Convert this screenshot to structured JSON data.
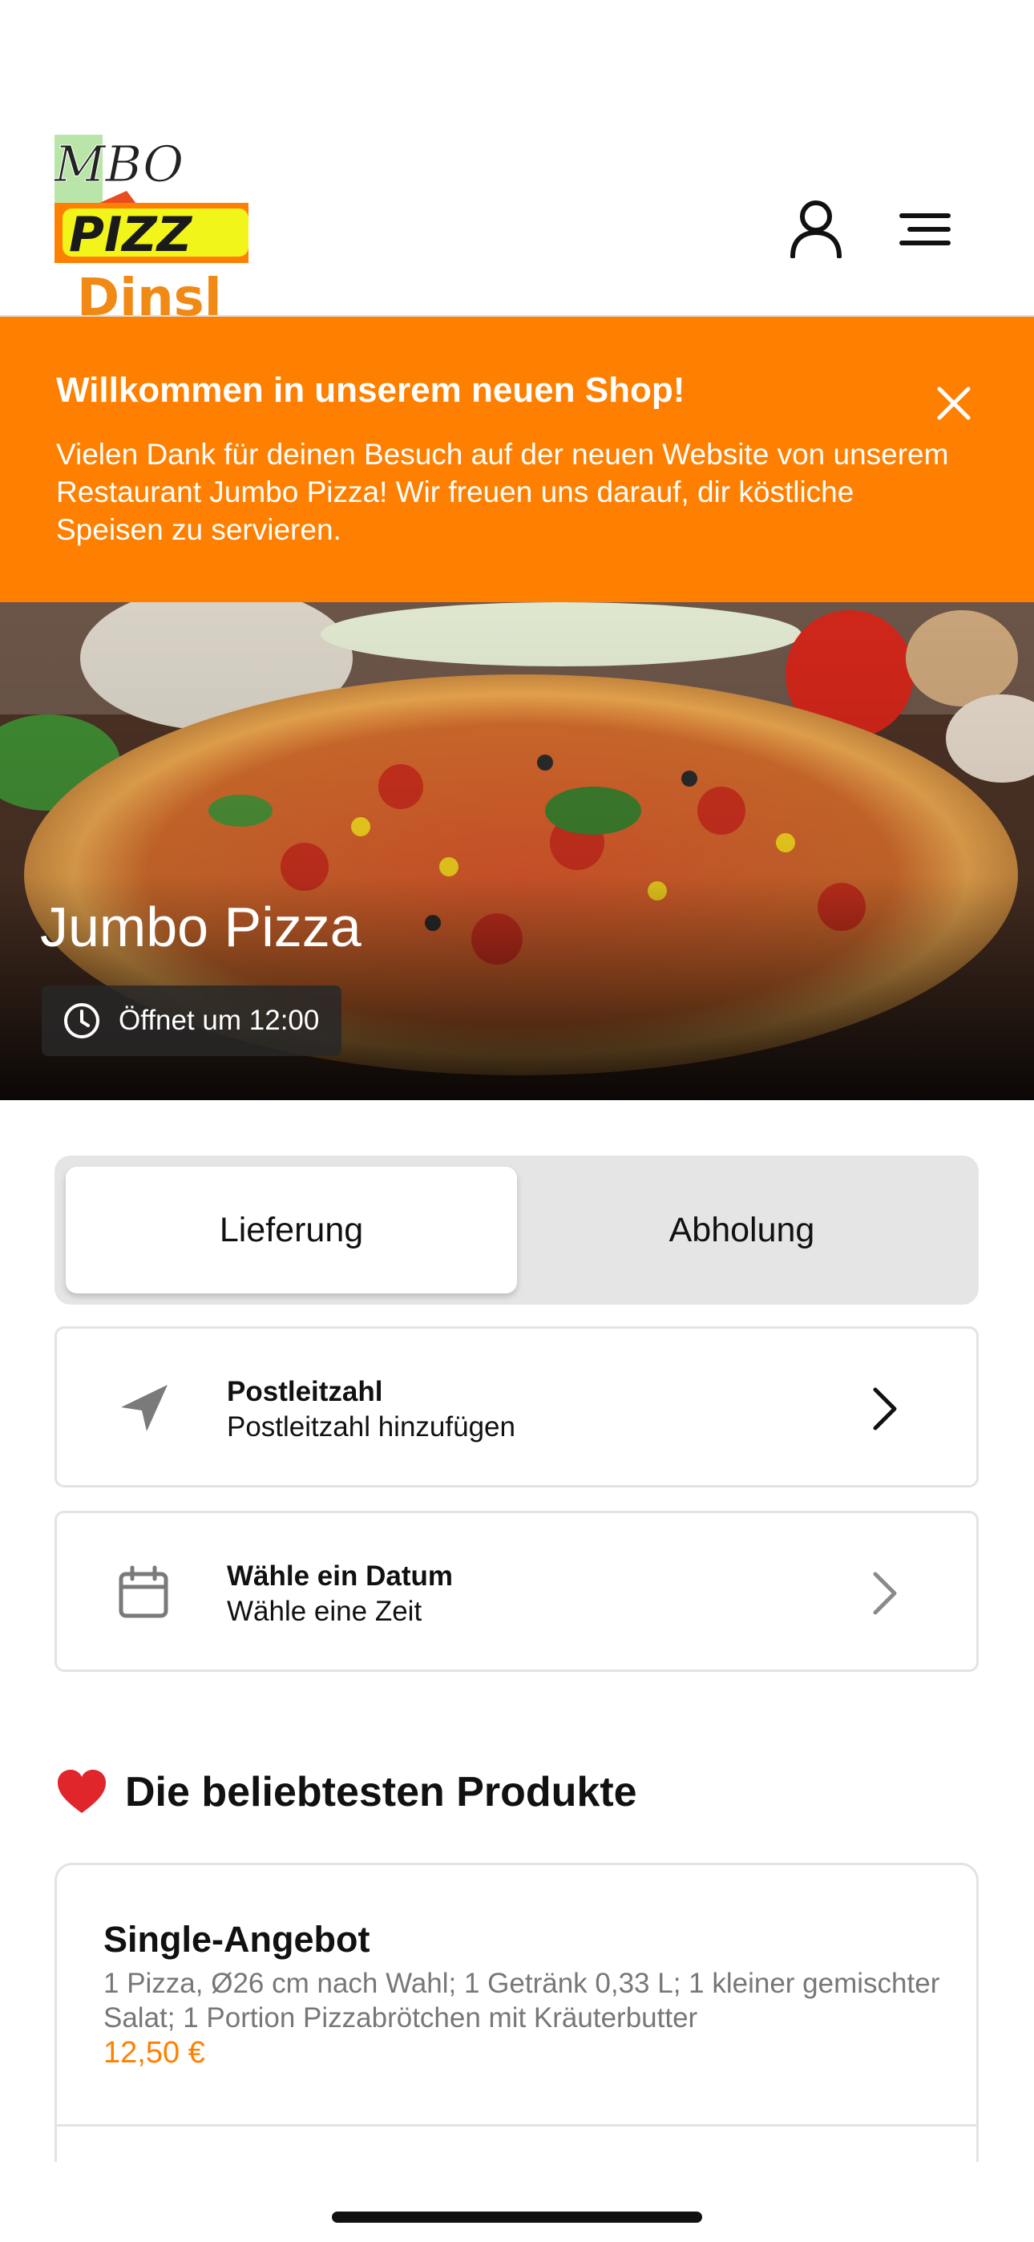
{
  "header": {
    "logo_text_top": "MBO",
    "logo_text_mid": "PIZZ",
    "logo_text_bottom": "Dinsl",
    "icons": [
      "user-icon",
      "menu-icon"
    ]
  },
  "banner": {
    "title": "Willkommen in unserem neuen Shop!",
    "text": "Vielen Dank für deinen Besuch auf der neuen Website von unserem Restaurant Jumbo Pizza! Wir freuen uns darauf, dir köstliche Speisen zu servieren.",
    "background": "#ff8000"
  },
  "hero": {
    "title": "Jumbo Pizza",
    "hours": "Öffnet um 12:00"
  },
  "order_mode": {
    "options": [
      "Lieferung",
      "Abholung"
    ],
    "selected": "Lieferung"
  },
  "postal": {
    "title": "Postleitzahl",
    "subtitle": "Postleitzahl hinzufügen"
  },
  "date": {
    "title": "Wähle ein Datum",
    "subtitle": "Wähle eine Zeit"
  },
  "popular": {
    "title": "Die beliebtesten Produkte"
  },
  "product": {
    "title": "Single-Angebot",
    "description": "1 Pizza, Ø26 cm nach Wahl; 1 Getränk 0,33 L; 1 kleiner gemischter Salat; 1 Portion Pizzabrötchen mit Kräuterbutter",
    "price": "12,50 €",
    "price_color": "#ff8000"
  }
}
